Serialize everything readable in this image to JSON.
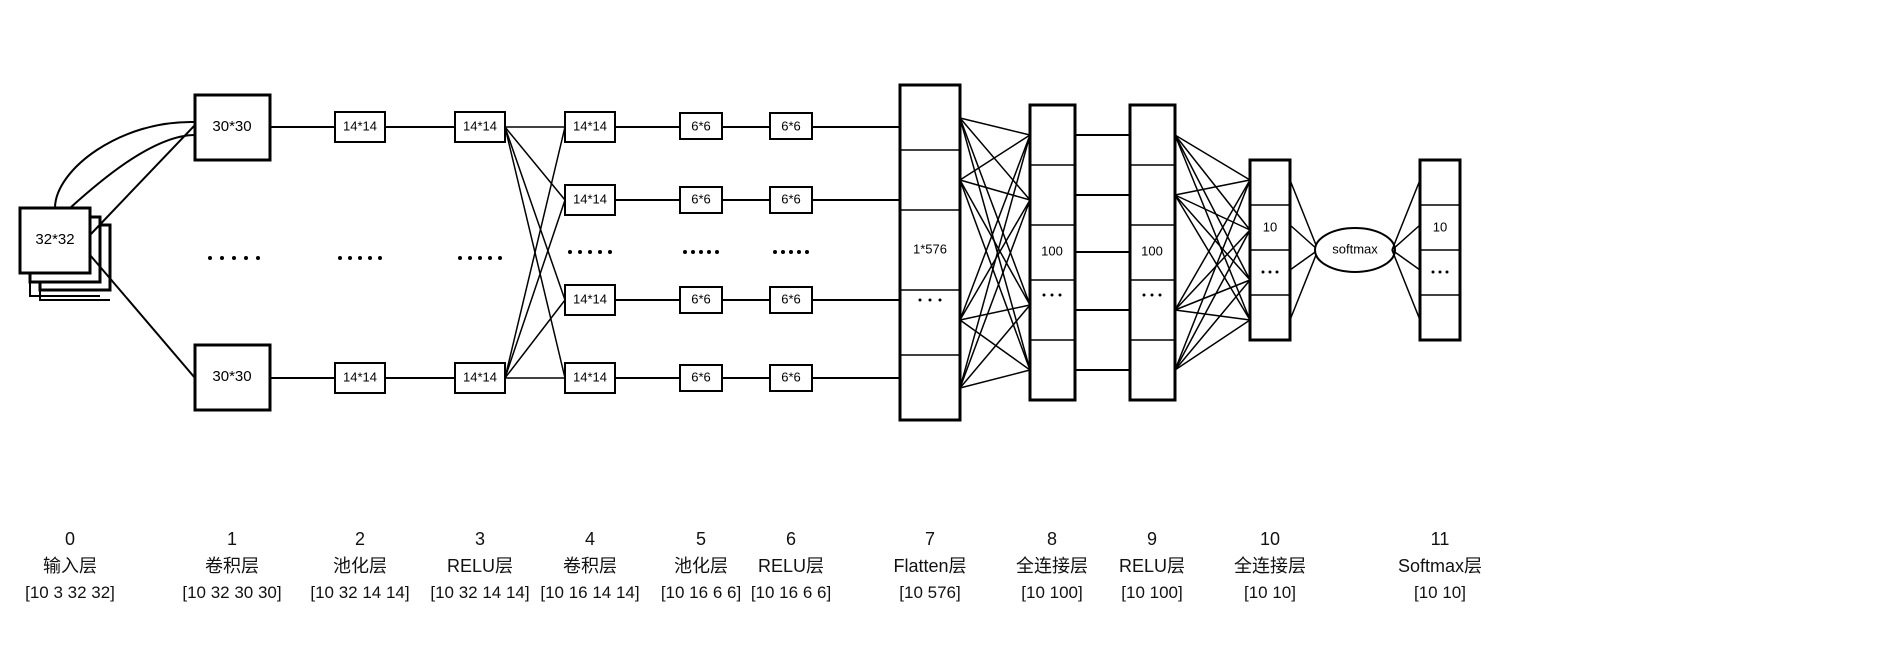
{
  "chart_data": {
    "type": "diagram",
    "description": "Convolutional Neural Network architecture diagram",
    "layers": [
      {
        "index": 0,
        "name": "输入层",
        "shape": "[10 3 32 32]",
        "node_label": "32*32"
      },
      {
        "index": 1,
        "name": "卷积层",
        "shape": "[10 32 30 30]",
        "node_label": "30*30"
      },
      {
        "index": 2,
        "name": "池化层",
        "shape": "[10 32 14 14]",
        "node_label": "14*14"
      },
      {
        "index": 3,
        "name": "RELU层",
        "shape": "[10 32 14 14]",
        "node_label": "14*14"
      },
      {
        "index": 4,
        "name": "卷积层",
        "shape": "[10 16 14 14]",
        "node_label": "14*14"
      },
      {
        "index": 5,
        "name": "池化层",
        "shape": "[10 16 6 6]",
        "node_label": "6*6"
      },
      {
        "index": 6,
        "name": "RELU层",
        "shape": "[10 16 6 6]",
        "node_label": "6*6"
      },
      {
        "index": 7,
        "name": "Flatten层",
        "shape": "[10 576]",
        "node_label": "1*576"
      },
      {
        "index": 8,
        "name": "全连接层",
        "shape": "[10 100]",
        "node_label": "100"
      },
      {
        "index": 9,
        "name": "RELU层",
        "shape": "[10 100]",
        "node_label": "100"
      },
      {
        "index": 10,
        "name": "全连接层",
        "shape": "[10 10]",
        "node_label": "10"
      },
      {
        "index": 11,
        "name": "Softmax层",
        "shape": "[10 10]",
        "node_label": "10"
      }
    ],
    "op_label": "softmax"
  }
}
